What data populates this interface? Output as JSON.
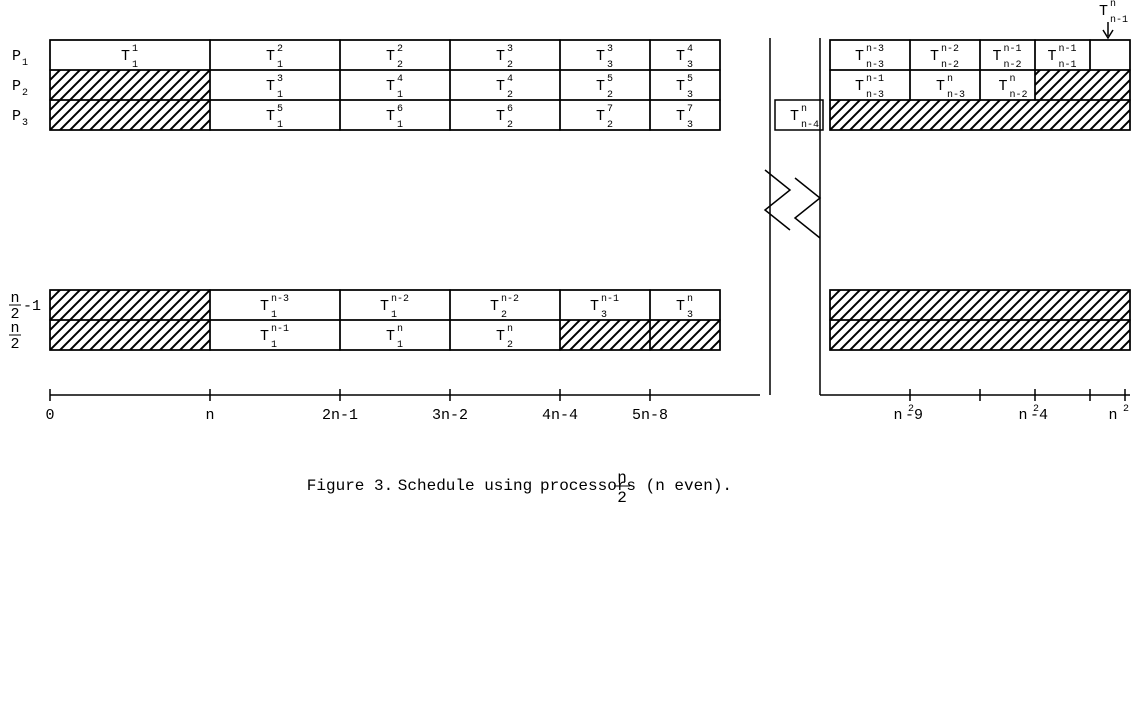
{
  "chart_data": {
    "type": "table",
    "title": "Schedule using n/2 processors (n even).",
    "figure_label": "Figure 3.",
    "left_group": {
      "processors": [
        "P1",
        "P2",
        "P3"
      ],
      "dot_processors": [
        "n/2-1",
        "n/2"
      ],
      "axis_ticks": [
        "0",
        "n",
        "2n-1",
        "3n-2",
        "4n-4",
        "5n-8"
      ],
      "rows": [
        {
          "proc": "P1",
          "cells": [
            {
              "T": "T",
              "sub": "1",
              "sup": "1"
            },
            {
              "T": "T",
              "sub": "1",
              "sup": "2"
            },
            {
              "T": "T",
              "sub": "2",
              "sup": "2"
            },
            {
              "T": "T",
              "sub": "2",
              "sup": "3"
            },
            {
              "T": "T",
              "sub": "3",
              "sup": "3"
            },
            {
              "T": "T",
              "sub": "3",
              "sup": "4"
            }
          ]
        },
        {
          "proc": "P2",
          "cells": [
            {
              "hatched": true
            },
            {
              "T": "T",
              "sub": "1",
              "sup": "3"
            },
            {
              "T": "T",
              "sub": "1",
              "sup": "4"
            },
            {
              "T": "T",
              "sub": "2",
              "sup": "4"
            },
            {
              "T": "T",
              "sub": "2",
              "sup": "5"
            },
            {
              "T": "T",
              "sub": "3",
              "sup": "5"
            }
          ]
        },
        {
          "proc": "P3",
          "cells": [
            {
              "hatched": true
            },
            {
              "T": "T",
              "sub": "1",
              "sup": "5"
            },
            {
              "T": "T",
              "sub": "1",
              "sup": "6"
            },
            {
              "T": "T",
              "sub": "2",
              "sup": "6"
            },
            {
              "T": "T",
              "sub": "2",
              "sup": "7"
            },
            {
              "T": "T",
              "sub": "3",
              "sup": "7"
            }
          ]
        },
        {
          "proc": "n/2-1",
          "cells": [
            {
              "hatched": true
            },
            {
              "T": "T",
              "sub": "1",
              "sup": "n-3"
            },
            {
              "T": "T",
              "sub": "1",
              "sup": "n-2"
            },
            {
              "T": "T",
              "sub": "2",
              "sup": "n-2"
            },
            {
              "T": "T",
              "sub": "3",
              "sup": "n-1"
            },
            {
              "T": "T",
              "sub": "3",
              "sup": "n"
            }
          ]
        },
        {
          "proc": "n/2",
          "cells": [
            {
              "hatched": true
            },
            {
              "T": "T",
              "sub": "1",
              "sup": "n-1"
            },
            {
              "T": "T",
              "sub": "1",
              "sup": "n"
            },
            {
              "T": "T",
              "sub": "2",
              "sup": "n"
            },
            {
              "hatched": true
            },
            {
              "hatched": true
            }
          ]
        }
      ]
    },
    "right_group": {
      "axis_ticks": [
        "n²-9",
        "n²-4",
        "n²"
      ],
      "outside_cell": {
        "T": "T",
        "sub": "n-4",
        "sup": "n"
      },
      "arrow_label": {
        "T": "T",
        "sub": "n-1",
        "sup": "n"
      },
      "rows": [
        {
          "proc": "P1",
          "cells": [
            {
              "T": "T",
              "sub": "n-3",
              "sup": "n-3"
            },
            {
              "T": "T",
              "sub": "n-2",
              "sup": "n-2"
            },
            {
              "T": "T",
              "sub": "n-2",
              "sup": "n-1"
            },
            {
              "T": "T",
              "sub": "n-1",
              "sup": "n-1"
            }
          ],
          "trailing_hatched": false,
          "trailing_empty": true
        },
        {
          "proc": "P2",
          "cells": [
            {
              "T": "T",
              "sub": "n-3",
              "sup": "n-1"
            },
            {
              "T": "T",
              "sub": "n-3",
              "sup": "n"
            },
            {
              "T": "T",
              "sub": "n-2",
              "sup": "n"
            }
          ],
          "trailing_hatched": true
        },
        {
          "proc": "P3",
          "cells": [],
          "fully_hatched": true
        }
      ],
      "bottom_rows_fully_hatched": 2
    }
  },
  "caption": {
    "fig": "Figure 3.",
    "text_before": "Schedule using ",
    "frac_top": "n",
    "frac_bot": "2",
    "text_after": " processors (n even)."
  }
}
